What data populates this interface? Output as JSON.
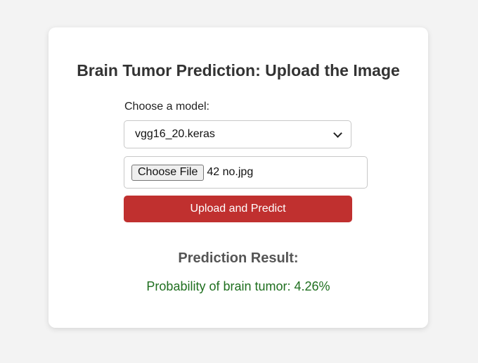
{
  "page": {
    "title": "Brain Tumor Prediction: Upload the Image"
  },
  "form": {
    "model_label": "Choose a model:",
    "model_selected": "vgg16_20.keras",
    "file_button_label": "Choose File",
    "file_name": "42 no.jpg",
    "submit_label": "Upload and Predict"
  },
  "result": {
    "heading": "Prediction Result:",
    "text": "Probability of brain tumor: 4.26%"
  },
  "colors": {
    "page_background": "#f3f3f3",
    "card_background": "#ffffff",
    "submit_button": "#c0302f",
    "result_text": "#1f6f1f"
  },
  "icons": {
    "select_arrow": "chevron-down-icon"
  }
}
